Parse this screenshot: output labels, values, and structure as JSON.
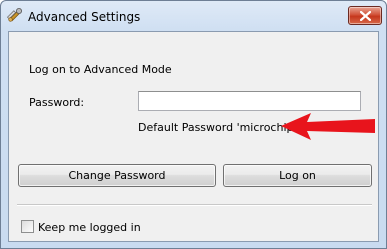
{
  "window": {
    "title": "Advanced Settings",
    "app_icon": "tools-icon",
    "close_icon": "close-icon"
  },
  "form": {
    "heading": "Log on to Advanced Mode",
    "password_label": "Password:",
    "password_value": "",
    "hint": "Default Password 'microchip'",
    "arrow_color": "#e8141c"
  },
  "buttons": {
    "change_password": "Change Password",
    "log_on": "Log on"
  },
  "options": {
    "keep_logged_in_label": "Keep me logged in",
    "keep_logged_in_checked": false
  }
}
